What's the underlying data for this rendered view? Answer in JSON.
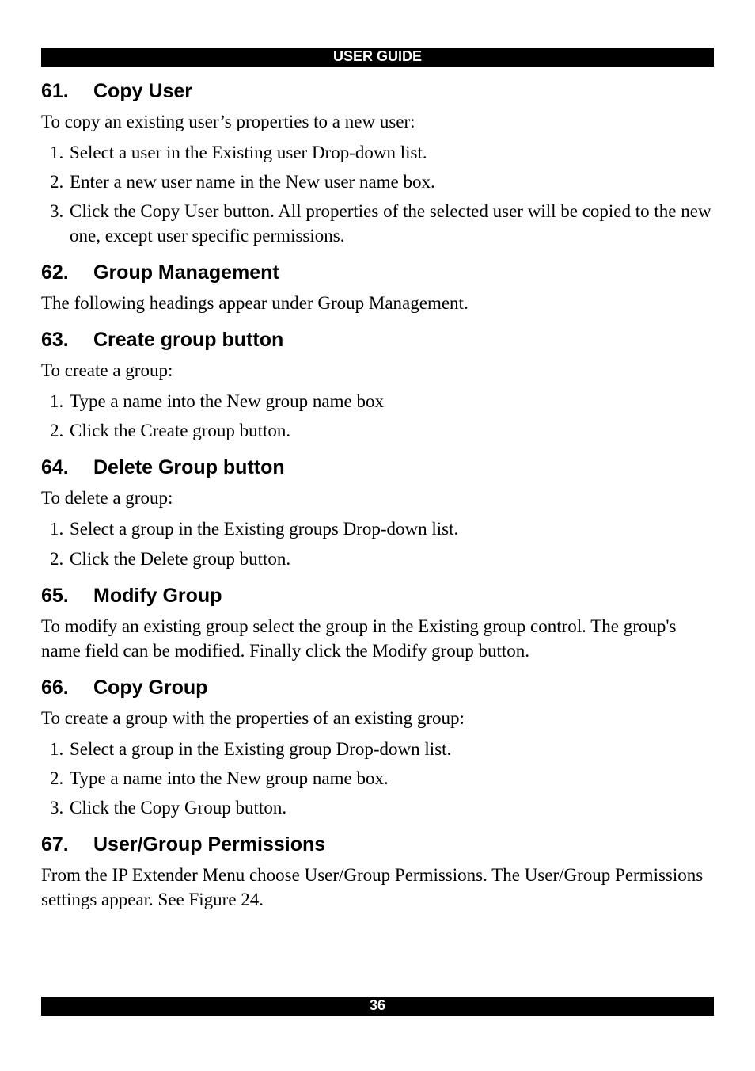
{
  "header": {
    "title": "USER GUIDE"
  },
  "footer": {
    "page_number": "36"
  },
  "sections": [
    {
      "num": "61.",
      "title": "Copy User",
      "intro": "To copy an existing user’s properties to a new user:",
      "steps": [
        "Select a user in the Existing user Drop-down list.",
        "Enter a new user name in the New user name box.",
        "Click the Copy User button. All properties of the selected user will be copied to the new one, except user specific permissions."
      ]
    },
    {
      "num": "62.",
      "title": "Group Management",
      "intro": "The following headings appear under Group Management."
    },
    {
      "num": "63.",
      "title": "Create group button",
      "intro": "To create a group:",
      "steps": [
        "Type a name into the New group name box",
        "Click the Create group button."
      ]
    },
    {
      "num": "64.",
      "title": "Delete Group button",
      "intro": "To delete a group:",
      "steps": [
        "Select a group in the Existing groups Drop-down list.",
        "Click the Delete group button."
      ]
    },
    {
      "num": "65.",
      "title": "Modify Group",
      "intro": "To modify an existing group select the group in the Existing group control. The group's name field can be modified. Finally click the Modify group button."
    },
    {
      "num": "66.",
      "title": "Copy Group",
      "intro": "To create a group with the properties of an existing group:",
      "steps": [
        "Select a group in the Existing group Drop-down list.",
        "Type a name into the New group name box.",
        "Click the Copy Group button."
      ]
    },
    {
      "num": "67.",
      "title": "User/Group Permissions",
      "intro": "From the IP Extender Menu choose User/Group Permissions. The User/Group Permissions settings appear. See Figure 24."
    }
  ]
}
